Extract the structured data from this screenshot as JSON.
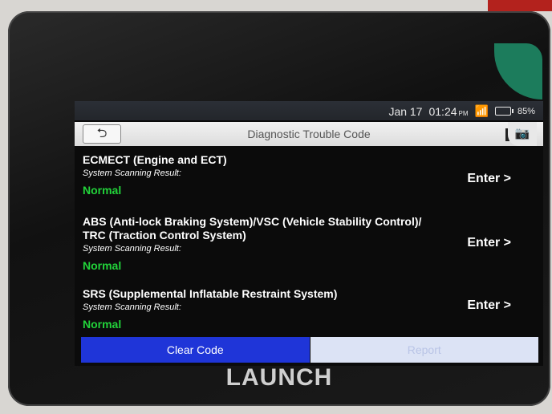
{
  "status_bar": {
    "date": "Jan 17",
    "time": "01:24",
    "ampm": "PM",
    "battery_pct": "85%"
  },
  "title_bar": {
    "back_icon": "back-arrow-icon",
    "title": "Diagnostic Trouble Code",
    "camera_icon": "camera-icon"
  },
  "systems": [
    {
      "name_lines": [
        "ECMECT (Engine and ECT)"
      ],
      "scan_label": "System Scanning Result:",
      "status": "Normal",
      "action": "Enter >"
    },
    {
      "name_lines": [
        "ABS (Anti-lock Braking System)/VSC (Vehicle Stability Control)/",
        "TRC (Traction Control System)"
      ],
      "scan_label": "System Scanning Result:",
      "status": "Normal",
      "action": "Enter >"
    },
    {
      "name_lines": [
        "SRS (Supplemental Inflatable Restraint System)"
      ],
      "scan_label": "System Scanning Result:",
      "status": "Normal",
      "action": "Enter >"
    }
  ],
  "footer": {
    "clear_label": "Clear Code",
    "report_label": "Report"
  },
  "device_brand": "LAUNCH",
  "colors": {
    "status_ok": "#22d33a",
    "primary_button": "#1f35d8"
  }
}
